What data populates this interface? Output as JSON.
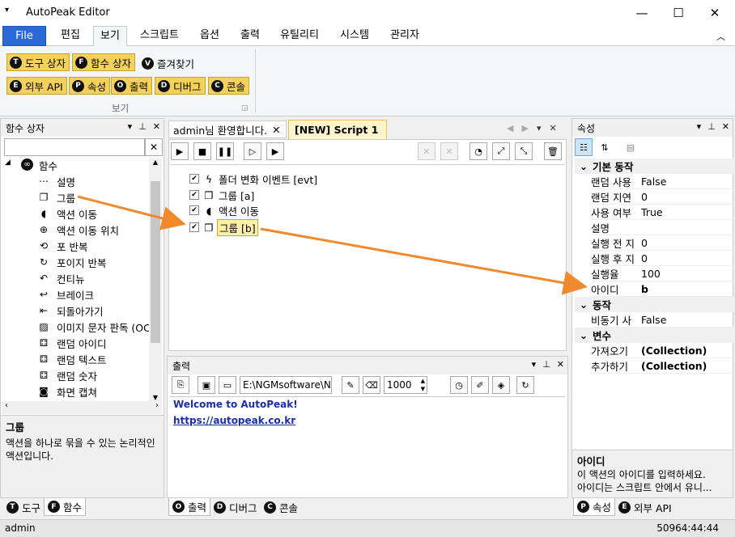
{
  "window": {
    "title": "AutoPeak Editor"
  },
  "ribbon_tabs": [
    "File",
    "편집",
    "보기",
    "스크립트",
    "옵션",
    "출력",
    "유틸리티",
    "시스템",
    "관리자"
  ],
  "ribbon": {
    "row1": [
      {
        "key": "T",
        "label": "도구 상자"
      },
      {
        "key": "F",
        "label": "함수 상자"
      }
    ],
    "favorites": {
      "key": "V",
      "label": "즐겨찾기"
    },
    "row2": [
      {
        "key": "E",
        "label": "외부 API"
      },
      {
        "key": "P",
        "label": "속성"
      },
      {
        "key": "O",
        "label": "출력"
      },
      {
        "key": "D",
        "label": "디버그"
      },
      {
        "key": "C",
        "label": "콘솔"
      }
    ],
    "group_label": "보기"
  },
  "left_panel": {
    "title": "함수 상자",
    "root": "함수",
    "items": [
      {
        "icon": "info",
        "label": "설명"
      },
      {
        "icon": "group",
        "label": "그룹"
      },
      {
        "icon": "pacman",
        "label": "액션 이동"
      },
      {
        "icon": "target",
        "label": "액션 이동 위치"
      },
      {
        "icon": "loop",
        "label": "포 반복"
      },
      {
        "icon": "loop-point",
        "label": "포이지 반복"
      },
      {
        "icon": "continue",
        "label": "컨티뉴"
      },
      {
        "icon": "break",
        "label": "브레이크"
      },
      {
        "icon": "return",
        "label": "되돌아가기"
      },
      {
        "icon": "image-text",
        "label": "이미지 문자 판독 (OC"
      },
      {
        "icon": "dice",
        "label": "랜덤 아이디"
      },
      {
        "icon": "dice",
        "label": "랜덤 텍스트"
      },
      {
        "icon": "dice",
        "label": "랜덤 숫자"
      },
      {
        "icon": "camera",
        "label": "화면 캡쳐"
      }
    ],
    "desc_title": "그룹",
    "desc_text": "액션을 하나로 묶을 수 있는 논리적인 액션입니다.",
    "tabs": [
      {
        "key": "T",
        "label": "도구"
      },
      {
        "key": "F",
        "label": "함수"
      }
    ]
  },
  "doc_tabs": [
    "admin님 환영합니다.",
    "[NEW] Script 1"
  ],
  "script_rows": [
    {
      "icon": "bolt",
      "label": "폴더 변화 이벤트 [evt]"
    },
    {
      "icon": "group",
      "label": "그룹 [a]"
    },
    {
      "icon": "pacman",
      "label": "액션 이동"
    },
    {
      "icon": "group",
      "label": "그룹 [b]"
    }
  ],
  "output_panel": {
    "title": "출력",
    "path": "E:\\NGMsoftware\\NG",
    "count": "1000",
    "welcome": "Welcome to AutoPeak!",
    "link": "https://autopeak.co.kr",
    "tabs": [
      {
        "key": "O",
        "label": "출력"
      },
      {
        "key": "D",
        "label": "디버그"
      },
      {
        "key": "C",
        "label": "콘솔"
      }
    ]
  },
  "props_panel": {
    "title": "속성",
    "categories": [
      {
        "name": "기본 동작",
        "rows": [
          {
            "k": "랜덤 사용",
            "v": "False"
          },
          {
            "k": "랜덤 지연",
            "v": "0"
          },
          {
            "k": "사용 여부",
            "v": "True"
          },
          {
            "k": "설명",
            "v": ""
          },
          {
            "k": "실행 전 지",
            "v": "0"
          },
          {
            "k": "실행 후 지",
            "v": "0"
          },
          {
            "k": "실행율",
            "v": "100"
          },
          {
            "k": "아이디",
            "v": "b"
          }
        ]
      },
      {
        "name": "동작",
        "rows": [
          {
            "k": "비동기 사",
            "v": "False"
          }
        ]
      },
      {
        "name": "변수",
        "rows": [
          {
            "k": "가져오기",
            "v": "(Collection)"
          },
          {
            "k": "추가하기",
            "v": "(Collection)"
          }
        ]
      }
    ],
    "desc_title": "아이디",
    "desc_text1": "이 액션의 아이디를 입력하세요.",
    "desc_text2": "아이디는 스크립트 안에서 유니...",
    "tabs": [
      {
        "key": "P",
        "label": "속성"
      },
      {
        "key": "E",
        "label": "외부 API"
      }
    ]
  },
  "status": {
    "left": "admin",
    "right": "50964:44:44"
  },
  "colors": {
    "accent": "#2b6ad6",
    "ribbon_button": "#f3d25c",
    "arrow": "#f08a2c"
  }
}
